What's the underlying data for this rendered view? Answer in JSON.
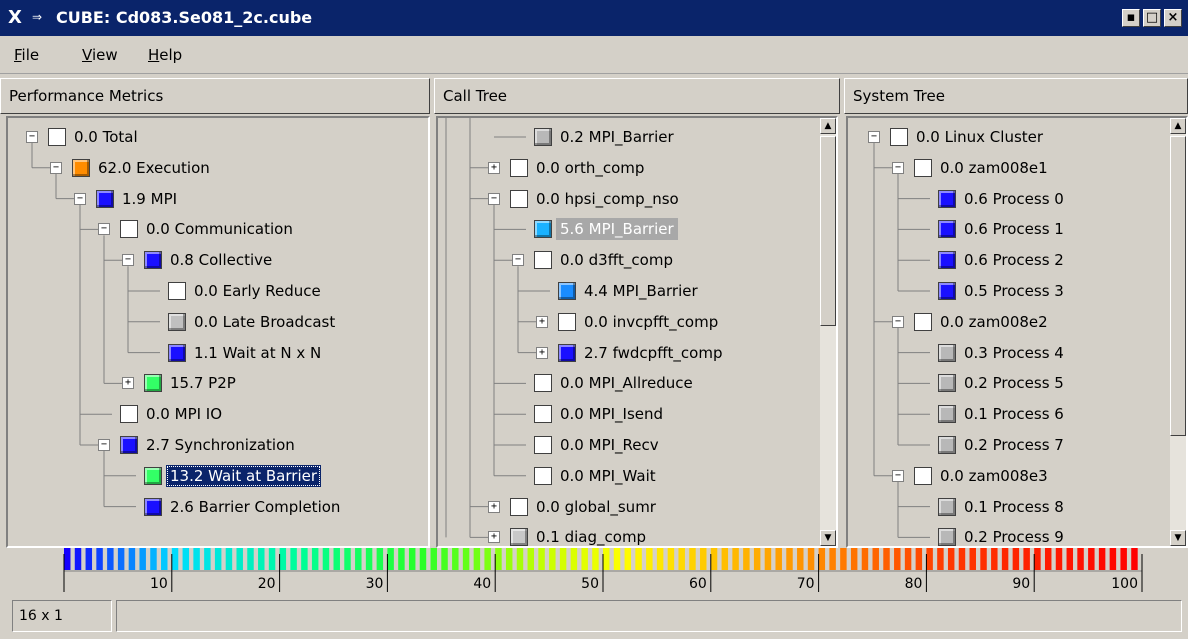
{
  "window": {
    "title": "CUBE:  Cd083.Se081_2c.cube",
    "controls": {
      "minimize": "▪",
      "maximize": "□",
      "close": "×"
    }
  },
  "menu": [
    {
      "label": "File",
      "accel": "F",
      "rest": "ile"
    },
    {
      "label": "View",
      "accel": "V",
      "rest": "iew"
    },
    {
      "label": "Help",
      "accel": "H",
      "rest": "elp"
    }
  ],
  "panes": {
    "metrics": {
      "header": "Performance Metrics"
    },
    "calltree": {
      "header": "Call Tree"
    },
    "systemtree": {
      "header": "System Tree"
    }
  },
  "metrics_tree": [
    {
      "label": "0.0 Total",
      "color": "#ffffff",
      "depth": 0,
      "expander": "minus"
    },
    {
      "label": "62.0 Execution",
      "color": "#ff8c00",
      "depth": 1,
      "expander": "minus"
    },
    {
      "label": "1.9 MPI",
      "color": "#1a10ff",
      "depth": 2,
      "expander": "minus"
    },
    {
      "label": "0.0 Communication",
      "color": "#ffffff",
      "depth": 3,
      "expander": "minus"
    },
    {
      "label": "0.8 Collective",
      "color": "#1a10ff",
      "depth": 4,
      "expander": "minus"
    },
    {
      "label": "0.0 Early Reduce",
      "color": "#ffffff",
      "depth": 5,
      "expander": "none"
    },
    {
      "label": "0.0 Late Broadcast",
      "color": "#c0c0c0",
      "depth": 5,
      "expander": "none"
    },
    {
      "label": "1.1 Wait at N x N",
      "color": "#1a10ff",
      "depth": 5,
      "expander": "none"
    },
    {
      "label": "15.7 P2P",
      "color": "#33ff66",
      "depth": 4,
      "expander": "plus"
    },
    {
      "label": "0.0 MPI IO",
      "color": "#ffffff",
      "depth": 3,
      "expander": "none"
    },
    {
      "label": "2.7 Synchronization",
      "color": "#1a10ff",
      "depth": 3,
      "expander": "minus"
    },
    {
      "label": "13.2 Wait at Barrier",
      "color": "#33ff66",
      "depth": 4,
      "expander": "none",
      "selected": true
    },
    {
      "label": "2.6 Barrier Completion",
      "color": "#1a10ff",
      "depth": 4,
      "expander": "none"
    }
  ],
  "call_tree": [
    {
      "label": "0.2 MPI_Barrier",
      "color": "#b8b8b8",
      "depth": 3,
      "expander": "none"
    },
    {
      "label": "0.0 orth_comp",
      "color": "#ffffff",
      "depth": 2,
      "expander": "plus"
    },
    {
      "label": "0.0 hpsi_comp_nso",
      "color": "#ffffff",
      "depth": 2,
      "expander": "minus"
    },
    {
      "label": "5.6 MPI_Barrier",
      "color": "#1ab2ff",
      "depth": 3,
      "expander": "none",
      "grayed": true
    },
    {
      "label": "0.0 d3fft_comp",
      "color": "#ffffff",
      "depth": 3,
      "expander": "minus"
    },
    {
      "label": "4.4 MPI_Barrier",
      "color": "#1a8cff",
      "depth": 4,
      "expander": "none"
    },
    {
      "label": "0.0 invcpfft_comp",
      "color": "#ffffff",
      "depth": 4,
      "expander": "plus"
    },
    {
      "label": "2.7 fwdcpfft_comp",
      "color": "#1a10ff",
      "depth": 4,
      "expander": "plus"
    },
    {
      "label": "0.0 MPI_Allreduce",
      "color": "#ffffff",
      "depth": 3,
      "expander": "none"
    },
    {
      "label": "0.0 MPI_Isend",
      "color": "#ffffff",
      "depth": 3,
      "expander": "none"
    },
    {
      "label": "0.0 MPI_Recv",
      "color": "#ffffff",
      "depth": 3,
      "expander": "none"
    },
    {
      "label": "0.0 MPI_Wait",
      "color": "#ffffff",
      "depth": 3,
      "expander": "none"
    },
    {
      "label": "0.0 global_sumr",
      "color": "#ffffff",
      "depth": 2,
      "expander": "plus"
    },
    {
      "label": "0.1 diag_comp",
      "color": "#c8c8c8",
      "depth": 2,
      "expander": "plus"
    }
  ],
  "system_tree": [
    {
      "label": "0.0 Linux Cluster",
      "color": "#ffffff",
      "depth": 0,
      "expander": "minus"
    },
    {
      "label": "0.0 zam008e1",
      "color": "#ffffff",
      "depth": 1,
      "expander": "minus"
    },
    {
      "label": "0.6 Process 0",
      "color": "#1a10ff",
      "depth": 2,
      "expander": "none"
    },
    {
      "label": "0.6 Process 1",
      "color": "#1a10ff",
      "depth": 2,
      "expander": "none"
    },
    {
      "label": "0.6 Process 2",
      "color": "#1a10ff",
      "depth": 2,
      "expander": "none"
    },
    {
      "label": "0.5 Process 3",
      "color": "#1a10ff",
      "depth": 2,
      "expander": "none"
    },
    {
      "label": "0.0 zam008e2",
      "color": "#ffffff",
      "depth": 1,
      "expander": "minus"
    },
    {
      "label": "0.3 Process 4",
      "color": "#b8b8b8",
      "depth": 2,
      "expander": "none"
    },
    {
      "label": "0.2 Process 5",
      "color": "#b8b8b8",
      "depth": 2,
      "expander": "none"
    },
    {
      "label": "0.1 Process 6",
      "color": "#b8b8b8",
      "depth": 2,
      "expander": "none"
    },
    {
      "label": "0.2 Process 7",
      "color": "#b8b8b8",
      "depth": 2,
      "expander": "none"
    },
    {
      "label": "0.0 zam008e3",
      "color": "#ffffff",
      "depth": 1,
      "expander": "minus"
    },
    {
      "label": "0.1 Process 8",
      "color": "#b8b8b8",
      "depth": 2,
      "expander": "none"
    },
    {
      "label": "0.2 Process 9",
      "color": "#b8b8b8",
      "depth": 2,
      "expander": "none"
    }
  ],
  "legend": {
    "ticks": [
      "10",
      "20",
      "30",
      "40",
      "50",
      "60",
      "70",
      "80",
      "90",
      "100"
    ]
  },
  "status": {
    "cell1": "16 x 1",
    "cell2": ""
  },
  "icons": {
    "expand": "plus-icon",
    "collapse": "minus-icon",
    "scroll_up": "arrow-up-icon",
    "scroll_down": "arrow-down-icon"
  }
}
